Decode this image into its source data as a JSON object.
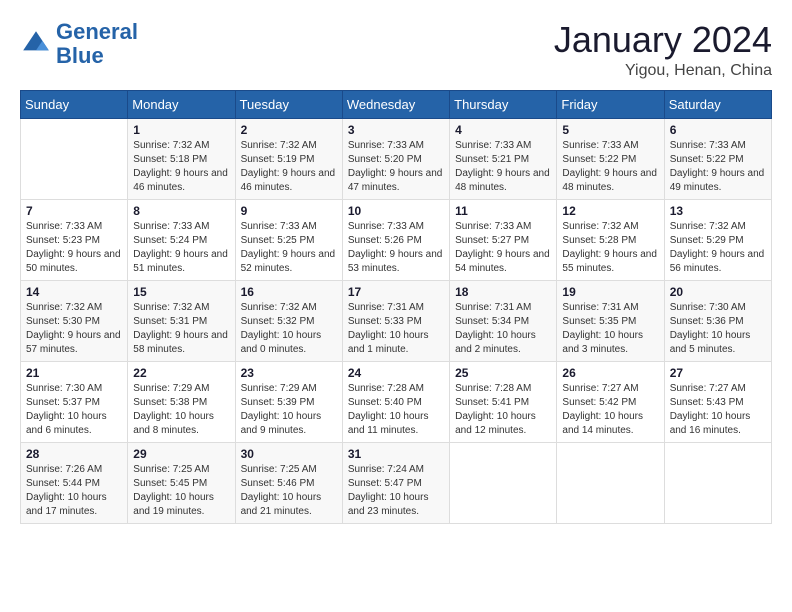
{
  "logo": {
    "text_general": "General",
    "text_blue": "Blue"
  },
  "title": {
    "month_year": "January 2024",
    "location": "Yigou, Henan, China"
  },
  "days_header": [
    "Sunday",
    "Monday",
    "Tuesday",
    "Wednesday",
    "Thursday",
    "Friday",
    "Saturday"
  ],
  "weeks": [
    [
      {
        "day": "",
        "sunrise": "",
        "sunset": "",
        "daylight": ""
      },
      {
        "day": "1",
        "sunrise": "Sunrise: 7:32 AM",
        "sunset": "Sunset: 5:18 PM",
        "daylight": "Daylight: 9 hours and 46 minutes."
      },
      {
        "day": "2",
        "sunrise": "Sunrise: 7:32 AM",
        "sunset": "Sunset: 5:19 PM",
        "daylight": "Daylight: 9 hours and 46 minutes."
      },
      {
        "day": "3",
        "sunrise": "Sunrise: 7:33 AM",
        "sunset": "Sunset: 5:20 PM",
        "daylight": "Daylight: 9 hours and 47 minutes."
      },
      {
        "day": "4",
        "sunrise": "Sunrise: 7:33 AM",
        "sunset": "Sunset: 5:21 PM",
        "daylight": "Daylight: 9 hours and 48 minutes."
      },
      {
        "day": "5",
        "sunrise": "Sunrise: 7:33 AM",
        "sunset": "Sunset: 5:22 PM",
        "daylight": "Daylight: 9 hours and 48 minutes."
      },
      {
        "day": "6",
        "sunrise": "Sunrise: 7:33 AM",
        "sunset": "Sunset: 5:22 PM",
        "daylight": "Daylight: 9 hours and 49 minutes."
      }
    ],
    [
      {
        "day": "7",
        "sunrise": "Sunrise: 7:33 AM",
        "sunset": "Sunset: 5:23 PM",
        "daylight": "Daylight: 9 hours and 50 minutes."
      },
      {
        "day": "8",
        "sunrise": "Sunrise: 7:33 AM",
        "sunset": "Sunset: 5:24 PM",
        "daylight": "Daylight: 9 hours and 51 minutes."
      },
      {
        "day": "9",
        "sunrise": "Sunrise: 7:33 AM",
        "sunset": "Sunset: 5:25 PM",
        "daylight": "Daylight: 9 hours and 52 minutes."
      },
      {
        "day": "10",
        "sunrise": "Sunrise: 7:33 AM",
        "sunset": "Sunset: 5:26 PM",
        "daylight": "Daylight: 9 hours and 53 minutes."
      },
      {
        "day": "11",
        "sunrise": "Sunrise: 7:33 AM",
        "sunset": "Sunset: 5:27 PM",
        "daylight": "Daylight: 9 hours and 54 minutes."
      },
      {
        "day": "12",
        "sunrise": "Sunrise: 7:32 AM",
        "sunset": "Sunset: 5:28 PM",
        "daylight": "Daylight: 9 hours and 55 minutes."
      },
      {
        "day": "13",
        "sunrise": "Sunrise: 7:32 AM",
        "sunset": "Sunset: 5:29 PM",
        "daylight": "Daylight: 9 hours and 56 minutes."
      }
    ],
    [
      {
        "day": "14",
        "sunrise": "Sunrise: 7:32 AM",
        "sunset": "Sunset: 5:30 PM",
        "daylight": "Daylight: 9 hours and 57 minutes."
      },
      {
        "day": "15",
        "sunrise": "Sunrise: 7:32 AM",
        "sunset": "Sunset: 5:31 PM",
        "daylight": "Daylight: 9 hours and 58 minutes."
      },
      {
        "day": "16",
        "sunrise": "Sunrise: 7:32 AM",
        "sunset": "Sunset: 5:32 PM",
        "daylight": "Daylight: 10 hours and 0 minutes."
      },
      {
        "day": "17",
        "sunrise": "Sunrise: 7:31 AM",
        "sunset": "Sunset: 5:33 PM",
        "daylight": "Daylight: 10 hours and 1 minute."
      },
      {
        "day": "18",
        "sunrise": "Sunrise: 7:31 AM",
        "sunset": "Sunset: 5:34 PM",
        "daylight": "Daylight: 10 hours and 2 minutes."
      },
      {
        "day": "19",
        "sunrise": "Sunrise: 7:31 AM",
        "sunset": "Sunset: 5:35 PM",
        "daylight": "Daylight: 10 hours and 3 minutes."
      },
      {
        "day": "20",
        "sunrise": "Sunrise: 7:30 AM",
        "sunset": "Sunset: 5:36 PM",
        "daylight": "Daylight: 10 hours and 5 minutes."
      }
    ],
    [
      {
        "day": "21",
        "sunrise": "Sunrise: 7:30 AM",
        "sunset": "Sunset: 5:37 PM",
        "daylight": "Daylight: 10 hours and 6 minutes."
      },
      {
        "day": "22",
        "sunrise": "Sunrise: 7:29 AM",
        "sunset": "Sunset: 5:38 PM",
        "daylight": "Daylight: 10 hours and 8 minutes."
      },
      {
        "day": "23",
        "sunrise": "Sunrise: 7:29 AM",
        "sunset": "Sunset: 5:39 PM",
        "daylight": "Daylight: 10 hours and 9 minutes."
      },
      {
        "day": "24",
        "sunrise": "Sunrise: 7:28 AM",
        "sunset": "Sunset: 5:40 PM",
        "daylight": "Daylight: 10 hours and 11 minutes."
      },
      {
        "day": "25",
        "sunrise": "Sunrise: 7:28 AM",
        "sunset": "Sunset: 5:41 PM",
        "daylight": "Daylight: 10 hours and 12 minutes."
      },
      {
        "day": "26",
        "sunrise": "Sunrise: 7:27 AM",
        "sunset": "Sunset: 5:42 PM",
        "daylight": "Daylight: 10 hours and 14 minutes."
      },
      {
        "day": "27",
        "sunrise": "Sunrise: 7:27 AM",
        "sunset": "Sunset: 5:43 PM",
        "daylight": "Daylight: 10 hours and 16 minutes."
      }
    ],
    [
      {
        "day": "28",
        "sunrise": "Sunrise: 7:26 AM",
        "sunset": "Sunset: 5:44 PM",
        "daylight": "Daylight: 10 hours and 17 minutes."
      },
      {
        "day": "29",
        "sunrise": "Sunrise: 7:25 AM",
        "sunset": "Sunset: 5:45 PM",
        "daylight": "Daylight: 10 hours and 19 minutes."
      },
      {
        "day": "30",
        "sunrise": "Sunrise: 7:25 AM",
        "sunset": "Sunset: 5:46 PM",
        "daylight": "Daylight: 10 hours and 21 minutes."
      },
      {
        "day": "31",
        "sunrise": "Sunrise: 7:24 AM",
        "sunset": "Sunset: 5:47 PM",
        "daylight": "Daylight: 10 hours and 23 minutes."
      },
      {
        "day": "",
        "sunrise": "",
        "sunset": "",
        "daylight": ""
      },
      {
        "day": "",
        "sunrise": "",
        "sunset": "",
        "daylight": ""
      },
      {
        "day": "",
        "sunrise": "",
        "sunset": "",
        "daylight": ""
      }
    ]
  ]
}
